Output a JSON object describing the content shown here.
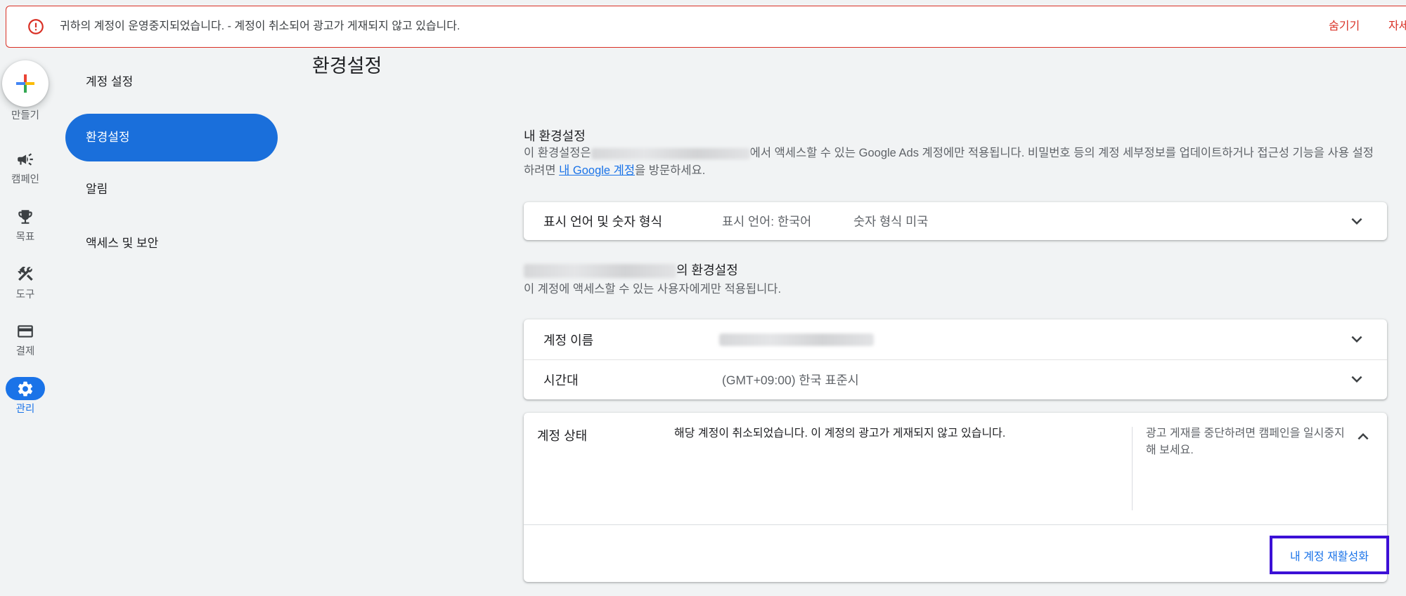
{
  "banner": {
    "icon": "error-circle-icon",
    "message": "귀하의 계정이 운영중지되었습니다. - 계정이 취소되어 광고가 게재되지 않고 있습니다.",
    "hide_label": "숨기기",
    "more_label": "자세"
  },
  "nav_rail": {
    "create_label": "만들기",
    "create_icon": "plus-icon",
    "items": [
      {
        "label": "캠페인",
        "icon": "megaphone-icon"
      },
      {
        "label": "목표",
        "icon": "trophy-icon"
      },
      {
        "label": "도구",
        "icon": "tools-icon"
      },
      {
        "label": "결제",
        "icon": "credit-card-icon"
      },
      {
        "label": "관리",
        "icon": "gear-icon",
        "active": true
      }
    ]
  },
  "sub_nav": {
    "items": [
      {
        "label": "계정 설정"
      },
      {
        "label": "환경설정",
        "active": true
      },
      {
        "label": "알림"
      },
      {
        "label": "액세스 및 보안"
      }
    ]
  },
  "page": {
    "title": "환경설정"
  },
  "my_prefs": {
    "heading": "내 환경설정",
    "desc_prefix": "이 환경설정은",
    "desc_middle": "에서 액세스할 수 있는 Google Ads 계정에만 적용됩니다. 비밀번호 등의 계정 세부정보를 업데이트하거나 접근성 기능을 사용 설정하려면 ",
    "link": "내 Google 계정",
    "desc_suffix": "을 방문하세요.",
    "display_card": {
      "label": "표시 언어 및 숫자 형식",
      "language": "표시 언어: 한국어",
      "number_format": "숫자 형식 미국"
    }
  },
  "account_prefs": {
    "heading_suffix": "의 환경설정",
    "desc": "이 계정에 액세스할 수 있는 사용자에게만 적용됩니다.",
    "rows": [
      {
        "label": "계정 이름"
      },
      {
        "label": "시간대",
        "value": "(GMT+09:00) 한국 표준시"
      }
    ]
  },
  "account_status": {
    "label": "계정 상태",
    "message": "해당 계정이 취소되었습니다. 이 계정의 광고가 게재되지 않고 있습니다.",
    "hint": "광고 게재를 중단하려면 캠페인을 일시중지해 보세요.",
    "reactivate_label": "내 계정 재활성화"
  },
  "colors": {
    "accent": "#1a73e8",
    "error": "#d93025",
    "highlight": "#3c10d6",
    "background": "#f1f3f4"
  }
}
